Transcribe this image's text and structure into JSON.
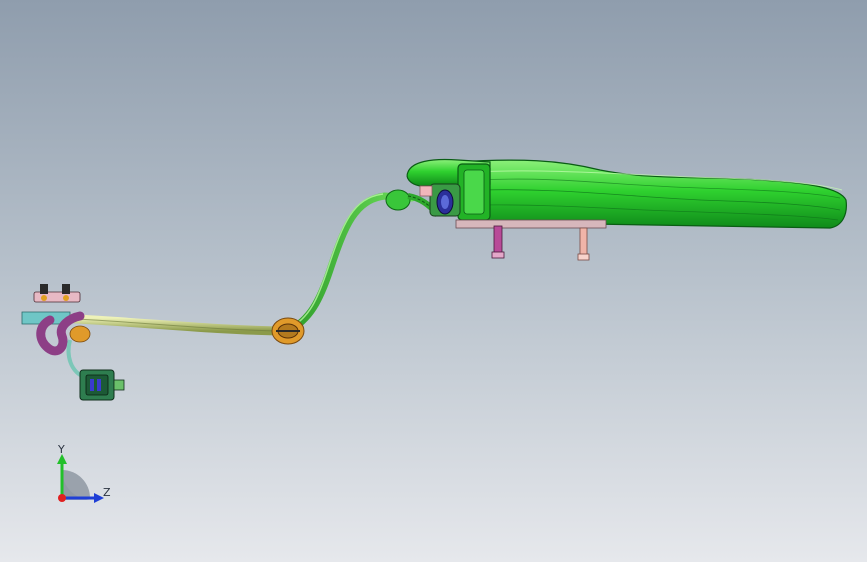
{
  "viewport": {
    "background_top": "#8f9dad",
    "background_bottom": "#e6e8ec"
  },
  "model": {
    "tube_color": "#3fc23a",
    "housing_color": "#2fd12f",
    "harness_color": "#c8d48a",
    "connector_color": "#2e7d4f",
    "clip_color": "#e09a2a"
  },
  "triad": {
    "x_axis_label": "",
    "y_axis_label": "Y",
    "z_axis_label": "Z",
    "y_color": "#22c02a",
    "z_color": "#1f3fd6",
    "origin_color": "#e02020"
  }
}
